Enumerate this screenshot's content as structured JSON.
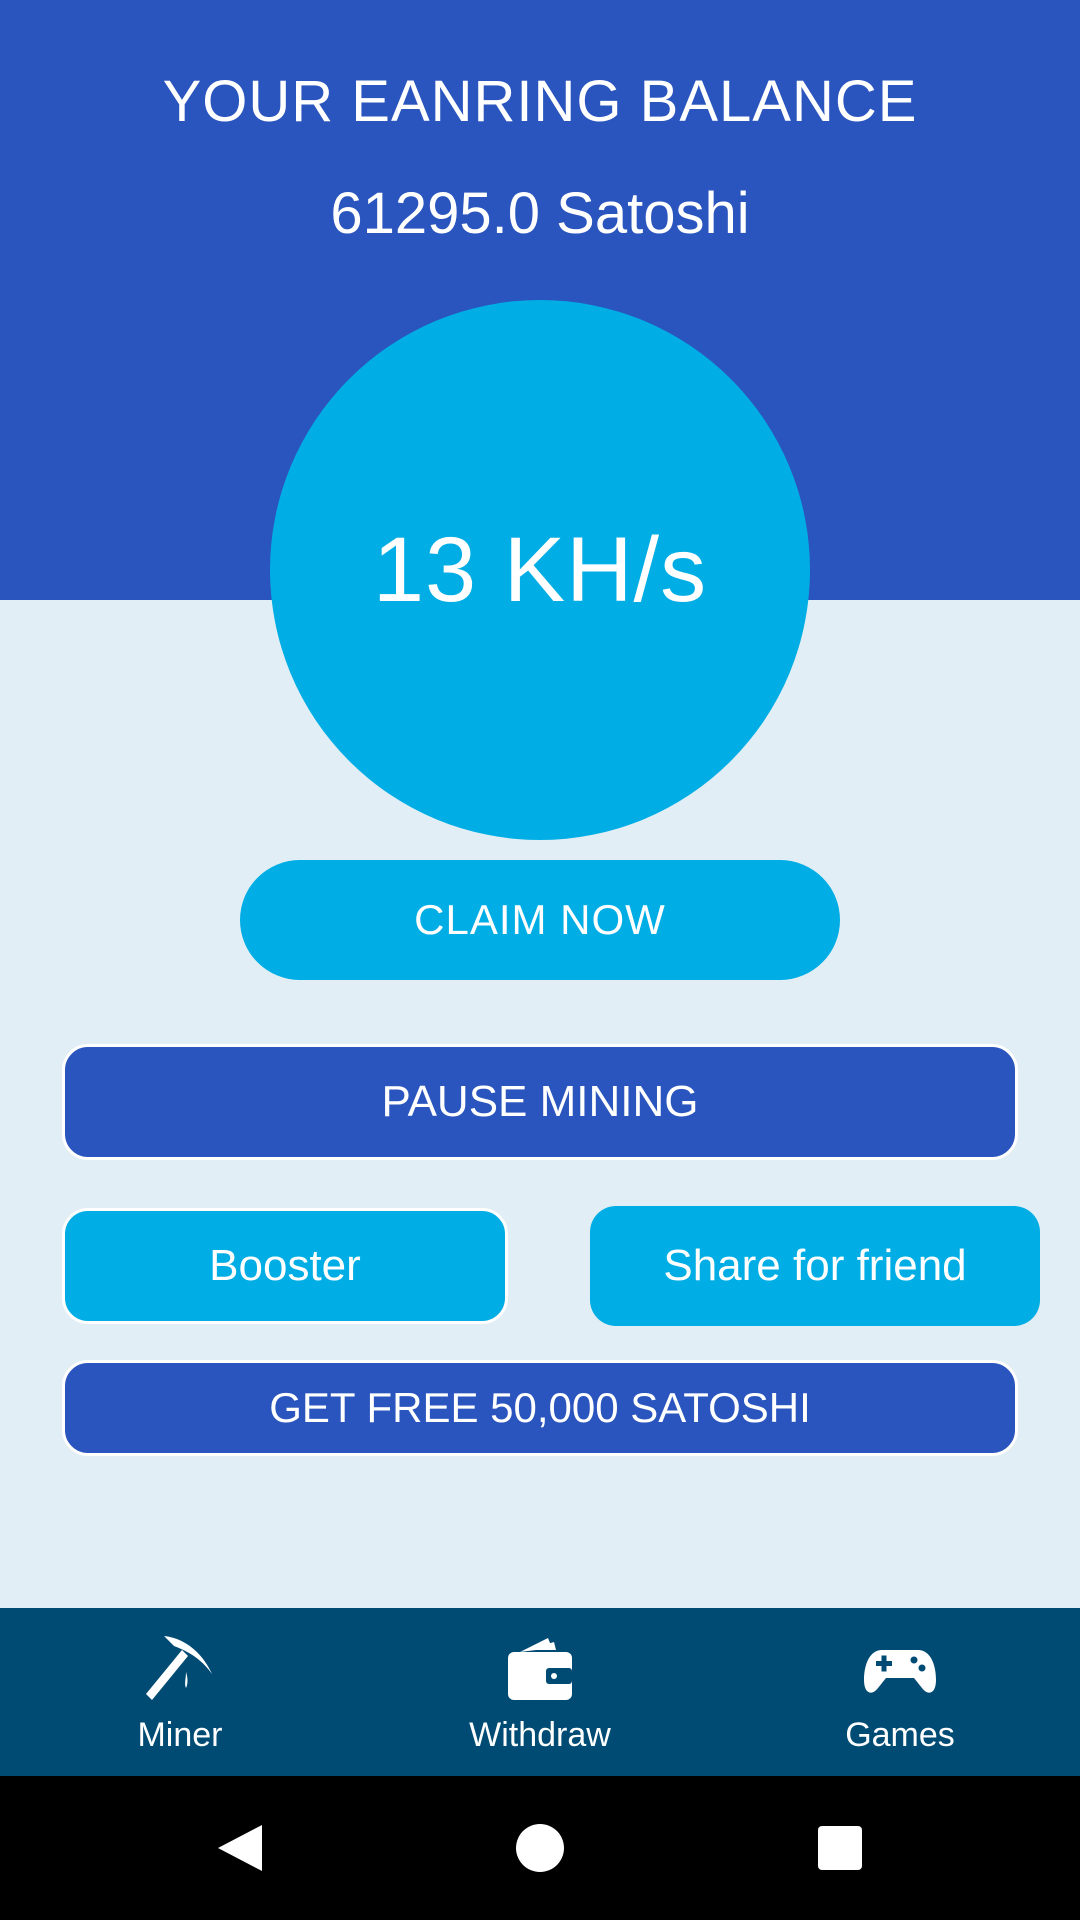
{
  "header": {
    "title": "YOUR EANRING BALANCE",
    "balance": "61295.0 Satoshi"
  },
  "miner": {
    "hash_rate": "13 KH/s"
  },
  "actions": {
    "claim_label": "CLAIM NOW",
    "pause_label": "PAUSE MINING",
    "booster_label": "Booster",
    "share_label": "Share for friend",
    "free_label": "GET FREE 50,000 SATOSHI"
  },
  "nav": {
    "items": [
      {
        "label": "Miner",
        "icon": "pickaxe-icon"
      },
      {
        "label": "Withdraw",
        "icon": "wallet-icon"
      },
      {
        "label": "Games",
        "icon": "gamepad-icon"
      }
    ]
  },
  "colors": {
    "primary_blue": "#2a55be",
    "accent_cyan": "#00aee5",
    "background": "#e2eef5",
    "nav_background": "#004b73"
  }
}
